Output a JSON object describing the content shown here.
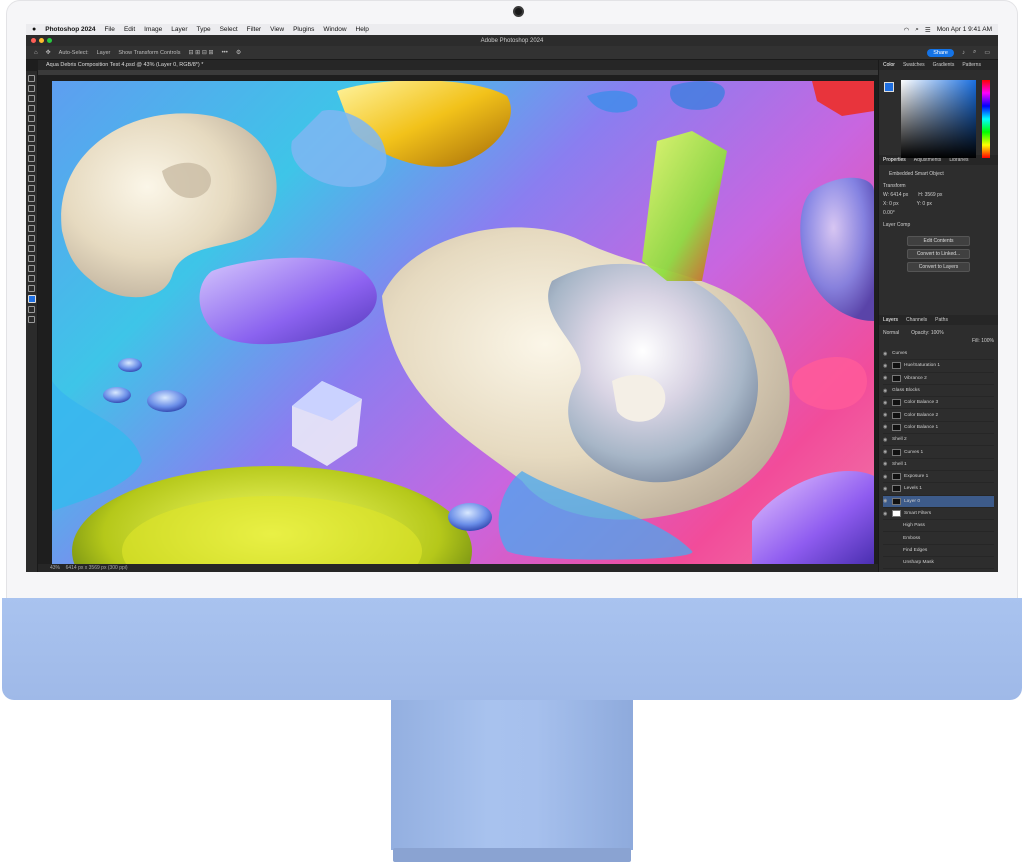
{
  "menubar": {
    "app": "Photoshop 2024",
    "items": [
      "File",
      "Edit",
      "Image",
      "Layer",
      "Type",
      "Select",
      "Filter",
      "View",
      "Plugins",
      "Window",
      "Help"
    ],
    "clock": "Mon Apr 1  9:41 AM"
  },
  "window": {
    "title": "Adobe Photoshop 2024"
  },
  "options_bar": {
    "auto_select": "Auto-Select:",
    "target": "Layer",
    "transform": "Show Transform Controls",
    "share": "Share"
  },
  "document_tab": {
    "label": "Aqua Debris Composition Test 4.psd @ 43% (Layer 0, RGB/8*) *"
  },
  "status": {
    "zoom": "43%",
    "info": "6414 px x 3569 px (300 ppi)"
  },
  "panels": {
    "color_tabs": [
      "Color",
      "Swatches",
      "Gradients",
      "Patterns"
    ],
    "props_tabs": [
      "Properties",
      "Adjustments",
      "Libraries"
    ],
    "props": {
      "object": "Embedded Smart Object",
      "transform": "Transform",
      "w": "W: 6414 px",
      "h": "H: 3569 px",
      "x": "X: 0 px",
      "y": "Y: 0 px",
      "angle": "0.00°",
      "layer_comp": "Layer Comp",
      "buttons": [
        "Edit Contents",
        "Convert to Linked...",
        "Convert to Layers"
      ]
    },
    "layers_tabs": [
      "Layers",
      "Channels",
      "Paths"
    ],
    "blend": "Normal",
    "opacity": "Opacity: 100%",
    "fill": "Fill: 100%",
    "layers": [
      "Curves",
      "Hue/Saturation 1",
      "Vibrance 2",
      "Glass Blocks",
      "Color Balance 3",
      "Color Balance 2",
      "Color Balance 1",
      "Shell 2",
      "Curves 1",
      "Shell 1",
      "Exposure 1",
      "Levels 1",
      "Layer 0",
      "Smart Filters",
      "High Pass",
      "Emboss",
      "Find Edges",
      "Unsharp Mask"
    ],
    "selected_layer": "Layer 0"
  },
  "colors": {
    "accent": "#1473e6",
    "chin": "#a9c3ef",
    "selected": "#3d5b8a"
  }
}
